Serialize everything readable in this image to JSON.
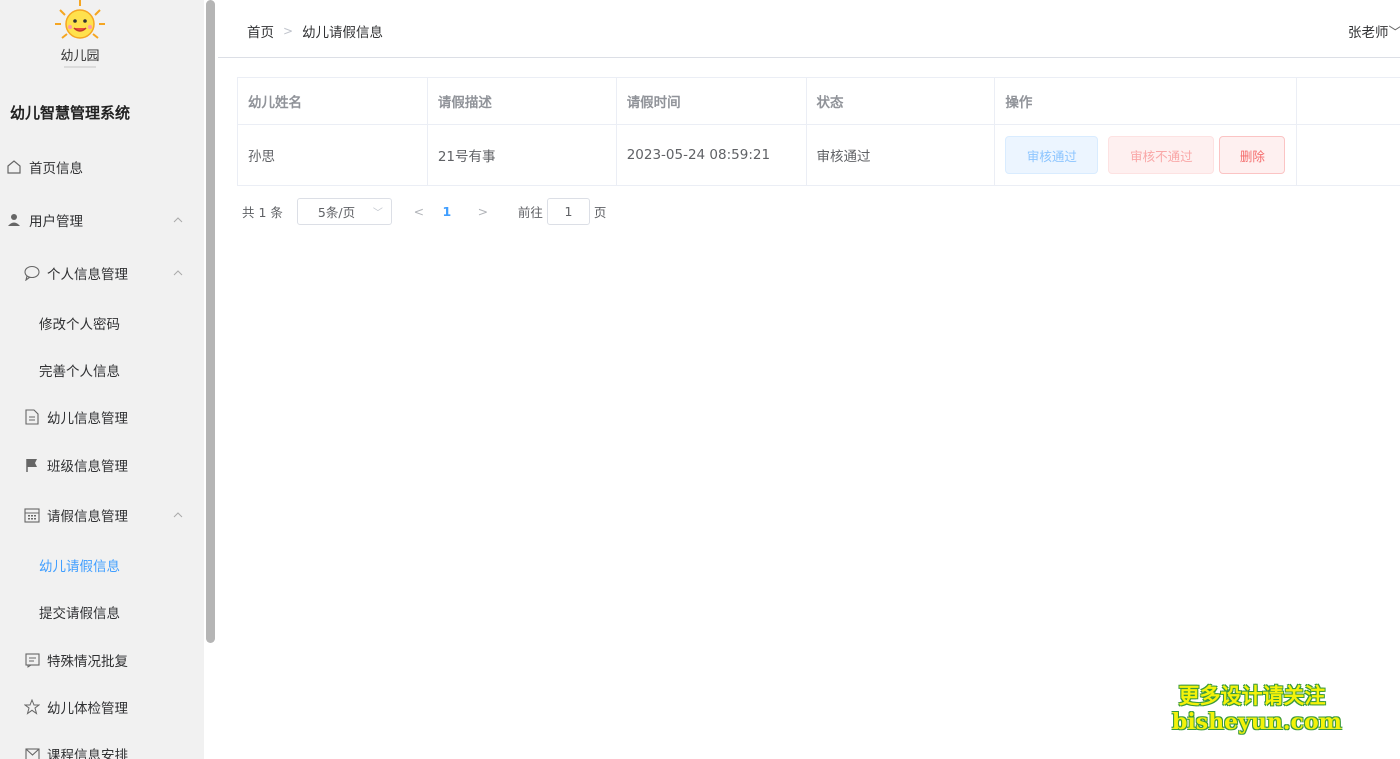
{
  "sidebar": {
    "logo_text": "幼儿园",
    "system_title": "幼儿智慧管理系统",
    "items": [
      {
        "label": "首页信息",
        "icon": "home-icon"
      },
      {
        "label": "用户管理",
        "icon": "user-icon"
      },
      {
        "label": "个人信息管理",
        "icon": "chat-bubble-icon"
      },
      {
        "label": "修改个人密码"
      },
      {
        "label": "完善个人信息"
      },
      {
        "label": "幼儿信息管理",
        "icon": "document-icon"
      },
      {
        "label": "班级信息管理",
        "icon": "flag-icon"
      },
      {
        "label": "请假信息管理",
        "icon": "calendar-icon"
      },
      {
        "label": "幼儿请假信息",
        "active": true
      },
      {
        "label": "提交请假信息"
      },
      {
        "label": "特殊情况批复",
        "icon": "message-icon"
      },
      {
        "label": "幼儿体检管理",
        "icon": "star-icon"
      },
      {
        "label": "课程信息安排",
        "icon": "mail-icon"
      }
    ]
  },
  "header": {
    "breadcrumb": [
      "首页",
      "幼儿请假信息"
    ],
    "user": "张老师"
  },
  "table": {
    "columns": [
      "幼儿姓名",
      "请假描述",
      "请假时间",
      "状态",
      "操作"
    ],
    "rows": [
      {
        "name": "孙思",
        "desc": "21号有事",
        "time": "2023-05-24 08:59:21",
        "status": "审核通过"
      }
    ],
    "actions": {
      "approve": "审核通过",
      "reject": "审核不通过",
      "delete": "删除"
    }
  },
  "pagination": {
    "total": "共 1 条",
    "page_size": "5条/页",
    "current_page": "1",
    "goto_label": "前往",
    "goto_value": "1",
    "page_suffix": "页"
  },
  "watermark": {
    "line1": "更多设计请关注",
    "line2": "bisheyun.com"
  },
  "colors": {
    "accent": "#409eff",
    "danger": "#f56c6c",
    "sidebar_bg": "#f1f1f1"
  }
}
